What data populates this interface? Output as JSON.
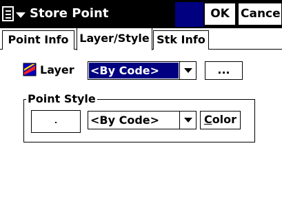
{
  "titlebar": {
    "title": "Store Point",
    "ok_label": "OK",
    "cancel_label": "Cancel",
    "menu_icon": "document-menu-icon",
    "accent_color": "#000080"
  },
  "tabs": [
    {
      "label": "Point Info",
      "active": false
    },
    {
      "label": "Layer/Style",
      "active": true
    },
    {
      "label": "Stk Info",
      "active": false
    }
  ],
  "layer": {
    "label": "Layer",
    "icon": "layer-icon",
    "value": "<By Code>",
    "browse_label": "..."
  },
  "point_style": {
    "group_title": "Point Style",
    "value": "<By Code>",
    "color_button_first": "C",
    "color_button_rest": "olor"
  }
}
